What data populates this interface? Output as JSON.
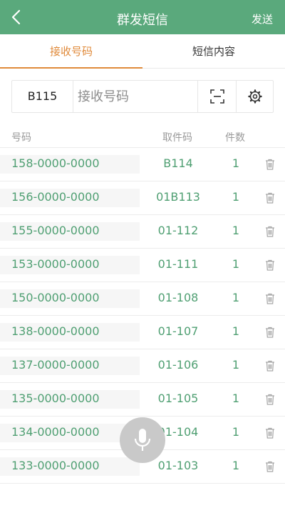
{
  "header": {
    "title": "群发短信",
    "send_label": "发送"
  },
  "tabs": [
    {
      "label": "接收号码"
    },
    {
      "label": "短信内容"
    }
  ],
  "input": {
    "prefix": "B115",
    "placeholder": "接收号码"
  },
  "columns": {
    "number": "号码",
    "code": "取件码",
    "count": "件数"
  },
  "rows": [
    {
      "number": "158-0000-0000",
      "code": "B114",
      "count": "1"
    },
    {
      "number": "156-0000-0000",
      "code": "01B113",
      "count": "1"
    },
    {
      "number": "155-0000-0000",
      "code": "01-112",
      "count": "1"
    },
    {
      "number": "153-0000-0000",
      "code": "01-111",
      "count": "1"
    },
    {
      "number": "150-0000-0000",
      "code": "01-108",
      "count": "1"
    },
    {
      "number": "138-0000-0000",
      "code": "01-107",
      "count": "1"
    },
    {
      "number": "137-0000-0000",
      "code": "01-106",
      "count": "1"
    },
    {
      "number": "135-0000-0000",
      "code": "01-105",
      "count": "1"
    },
    {
      "number": "134-0000-0000",
      "code": "01-104",
      "count": "1"
    },
    {
      "number": "133-0000-0000",
      "code": "01-103",
      "count": "1"
    }
  ],
  "colors": {
    "brand": "#5aa97c",
    "accent": "#e08a3a",
    "value_text": "#4f9f72"
  },
  "icons": {
    "back": "back-arrow-icon",
    "scan": "scan-icon",
    "settings": "gear-icon",
    "delete": "trash-icon",
    "voice": "microphone-icon"
  }
}
